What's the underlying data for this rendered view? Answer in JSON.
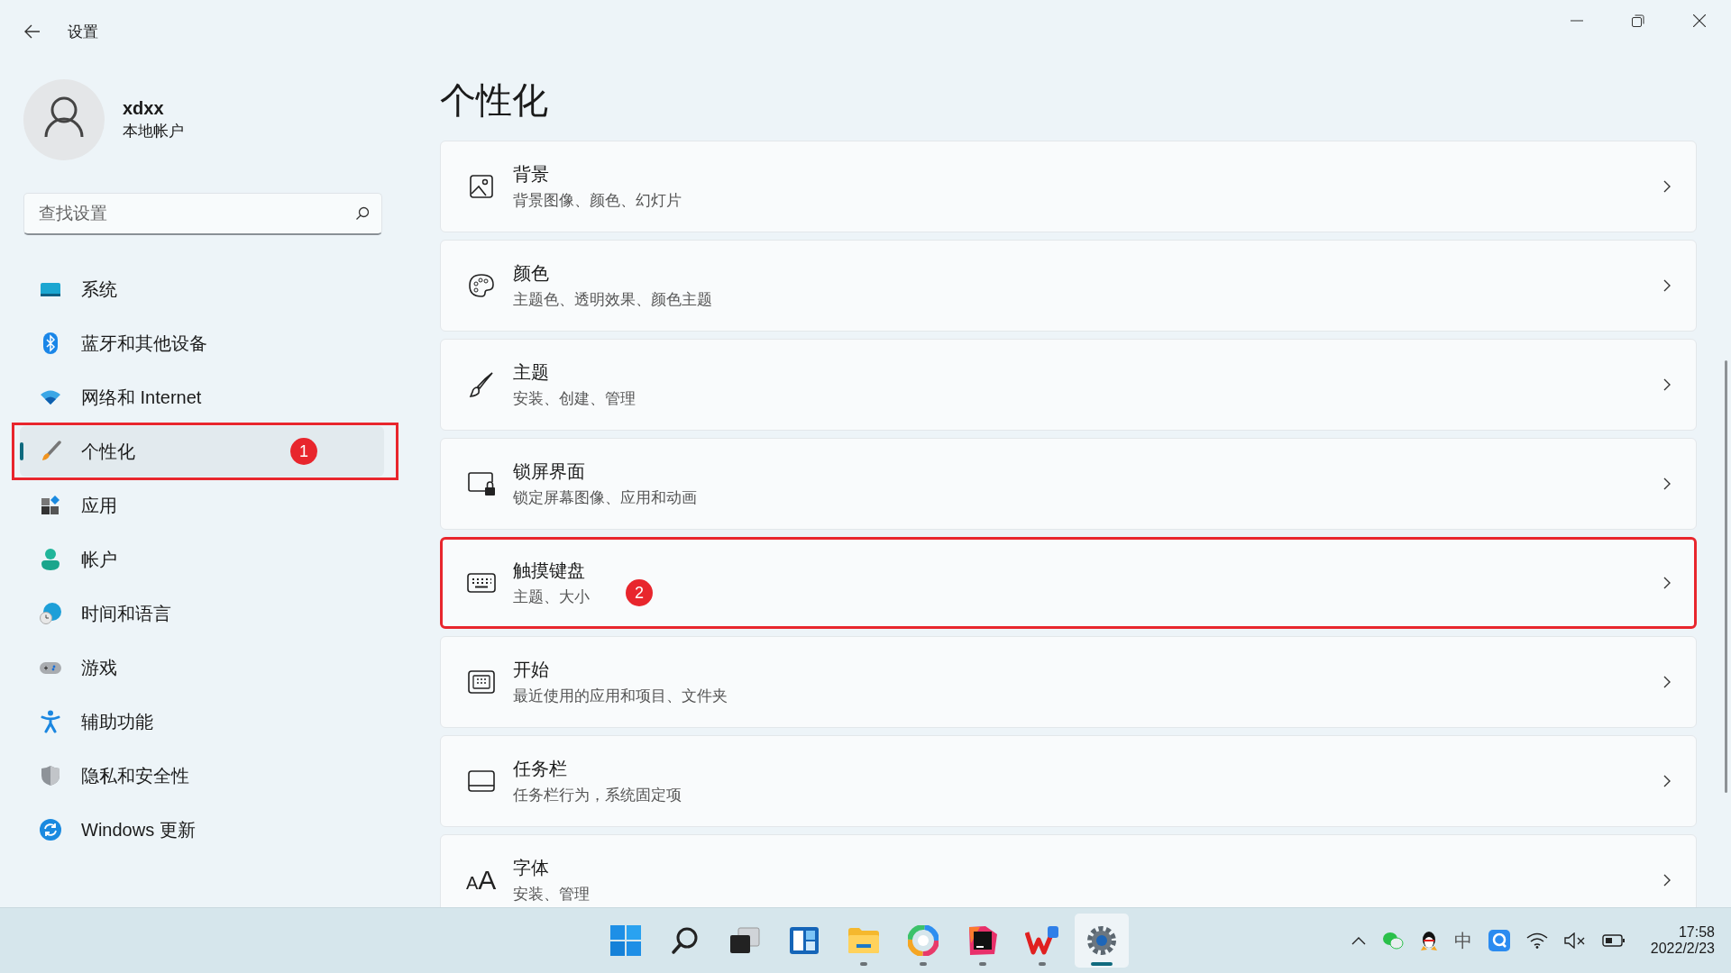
{
  "window": {
    "title": "设置"
  },
  "account": {
    "name": "xdxx",
    "type": "本地帐户"
  },
  "search": {
    "placeholder": "查找设置"
  },
  "sidebar": {
    "items": [
      {
        "kind": "system",
        "label": "系统",
        "selected": false,
        "highlighted": false
      },
      {
        "kind": "bluetooth",
        "label": "蓝牙和其他设备",
        "selected": false,
        "highlighted": false
      },
      {
        "kind": "network",
        "label": "网络和 Internet",
        "selected": false,
        "highlighted": false
      },
      {
        "kind": "personalization",
        "label": "个性化",
        "selected": true,
        "highlighted": true,
        "marker": "1"
      },
      {
        "kind": "apps",
        "label": "应用",
        "selected": false,
        "highlighted": false
      },
      {
        "kind": "accounts",
        "label": "帐户",
        "selected": false,
        "highlighted": false
      },
      {
        "kind": "time",
        "label": "时间和语言",
        "selected": false,
        "highlighted": false
      },
      {
        "kind": "gaming",
        "label": "游戏",
        "selected": false,
        "highlighted": false
      },
      {
        "kind": "accessibility",
        "label": "辅助功能",
        "selected": false,
        "highlighted": false
      },
      {
        "kind": "privacy",
        "label": "隐私和安全性",
        "selected": false,
        "highlighted": false
      },
      {
        "kind": "update",
        "label": "Windows 更新",
        "selected": false,
        "highlighted": false
      }
    ]
  },
  "page": {
    "title": "个性化",
    "cards": [
      {
        "kind": "background",
        "title": "背景",
        "subtitle": "背景图像、颜色、幻灯片",
        "highlighted": false
      },
      {
        "kind": "colors",
        "title": "颜色",
        "subtitle": "主题色、透明效果、颜色主题",
        "highlighted": false
      },
      {
        "kind": "themes",
        "title": "主题",
        "subtitle": "安装、创建、管理",
        "highlighted": false
      },
      {
        "kind": "lockscreen",
        "title": "锁屏界面",
        "subtitle": "锁定屏幕图像、应用和动画",
        "highlighted": false
      },
      {
        "kind": "keyboard",
        "title": "触摸键盘",
        "subtitle": "主题、大小",
        "highlighted": true,
        "marker": "2"
      },
      {
        "kind": "start",
        "title": "开始",
        "subtitle": "最近使用的应用和项目、文件夹",
        "highlighted": false
      },
      {
        "kind": "taskbar",
        "title": "任务栏",
        "subtitle": "任务栏行为，系统固定项",
        "highlighted": false
      },
      {
        "kind": "fonts",
        "title": "字体",
        "subtitle": "安装、管理",
        "highlighted": false,
        "icon_letters": [
          "A",
          "A"
        ]
      }
    ]
  },
  "taskbar": {
    "apps": [
      {
        "kind": "start",
        "running": false,
        "selected": false
      },
      {
        "kind": "search",
        "running": false,
        "selected": false
      },
      {
        "kind": "taskview",
        "running": false,
        "selected": false
      },
      {
        "kind": "widgets",
        "running": false,
        "selected": false
      },
      {
        "kind": "explorer",
        "running": true,
        "selected": false
      },
      {
        "kind": "colorwheel",
        "running": true,
        "selected": false
      },
      {
        "kind": "ide",
        "running": true,
        "selected": false
      },
      {
        "kind": "office",
        "running": true,
        "selected": false
      },
      {
        "kind": "settings",
        "running": true,
        "selected": true
      }
    ],
    "input_method": "中",
    "time": "17:58",
    "date": "2022/2/23"
  }
}
